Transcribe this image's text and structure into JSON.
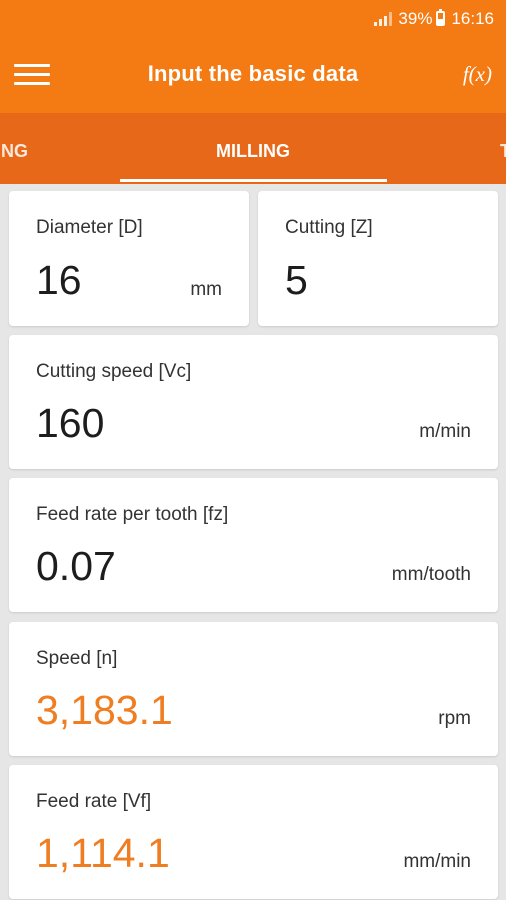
{
  "status_bar": {
    "battery": "39%",
    "time": "16:16"
  },
  "app_bar": {
    "title": "Input the basic data",
    "fx_label": "f(x)"
  },
  "tabs": {
    "prev": "NG",
    "active": "MILLING",
    "next": "T"
  },
  "fields": {
    "diameter": {
      "label": "Diameter [D]",
      "value": "16",
      "unit": "mm"
    },
    "cutting": {
      "label": "Cutting [Z]",
      "value": "5"
    },
    "cutting_speed": {
      "label": "Cutting speed [Vc]",
      "value": "160",
      "unit": "m/min"
    },
    "feed_per_tooth": {
      "label": "Feed rate per tooth [fz]",
      "value": "0.07",
      "unit": "mm/tooth"
    },
    "speed": {
      "label": "Speed [n]",
      "value": "3,183.1",
      "unit": "rpm"
    },
    "feed_rate": {
      "label": "Feed rate [Vf]",
      "value": "1,114.1",
      "unit": "mm/min"
    }
  },
  "colors": {
    "primary": "#f47a13",
    "tab_bar": "#e8681a",
    "result_value": "#ef7d22",
    "background": "#e6e6e6"
  }
}
